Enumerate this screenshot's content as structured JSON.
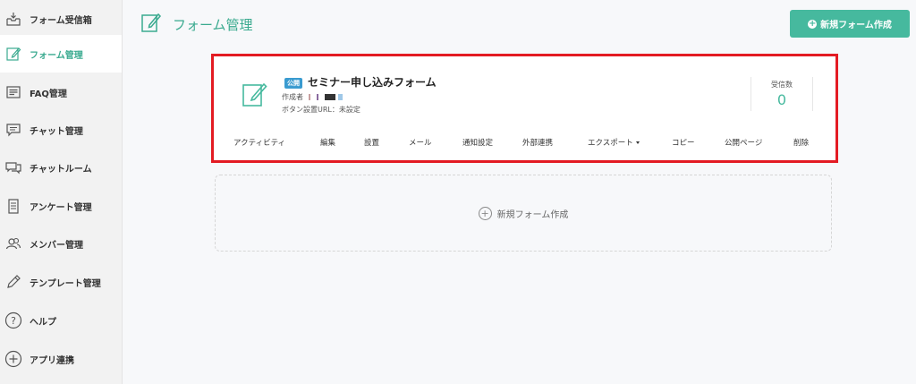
{
  "sidebar": {
    "items": [
      {
        "label": "フォーム受信箱",
        "icon": "inbox-icon",
        "active": false
      },
      {
        "label": "フォーム管理",
        "icon": "form-edit-icon",
        "active": true
      },
      {
        "label": "FAQ管理",
        "icon": "faq-icon",
        "active": false
      },
      {
        "label": "チャット管理",
        "icon": "chat-icon",
        "active": false
      },
      {
        "label": "チャットルーム",
        "icon": "chat-room-icon",
        "active": false
      },
      {
        "label": "アンケート管理",
        "icon": "survey-icon",
        "active": false
      },
      {
        "label": "メンバー管理",
        "icon": "members-icon",
        "active": false
      },
      {
        "label": "テンプレート管理",
        "icon": "pencil-icon",
        "active": false
      },
      {
        "label": "ヘルプ",
        "icon": "help-icon",
        "active": false
      },
      {
        "label": "アプリ連携",
        "icon": "plus-circle-icon",
        "active": false
      }
    ]
  },
  "header": {
    "title": "フォーム管理",
    "new_form_button": "新規フォーム作成"
  },
  "form_card": {
    "status_badge": "公開",
    "title": "セミナー申し込みフォーム",
    "author_label": "作成者",
    "button_url": "ボタン設置URL：未設定",
    "received_label": "受信数",
    "received_count": "0",
    "actions": [
      "アクティビティ",
      "編集",
      "設置",
      "メール",
      "通知設定",
      "外部連携",
      "エクスポート",
      "コピー",
      "公開ページ",
      "削除"
    ]
  },
  "add_new": {
    "label": "新規フォーム作成"
  },
  "colors": {
    "accent": "#3aaa8f",
    "button": "#46b99e",
    "highlight_border": "#e31b23",
    "badge": "#3a9bd0"
  }
}
